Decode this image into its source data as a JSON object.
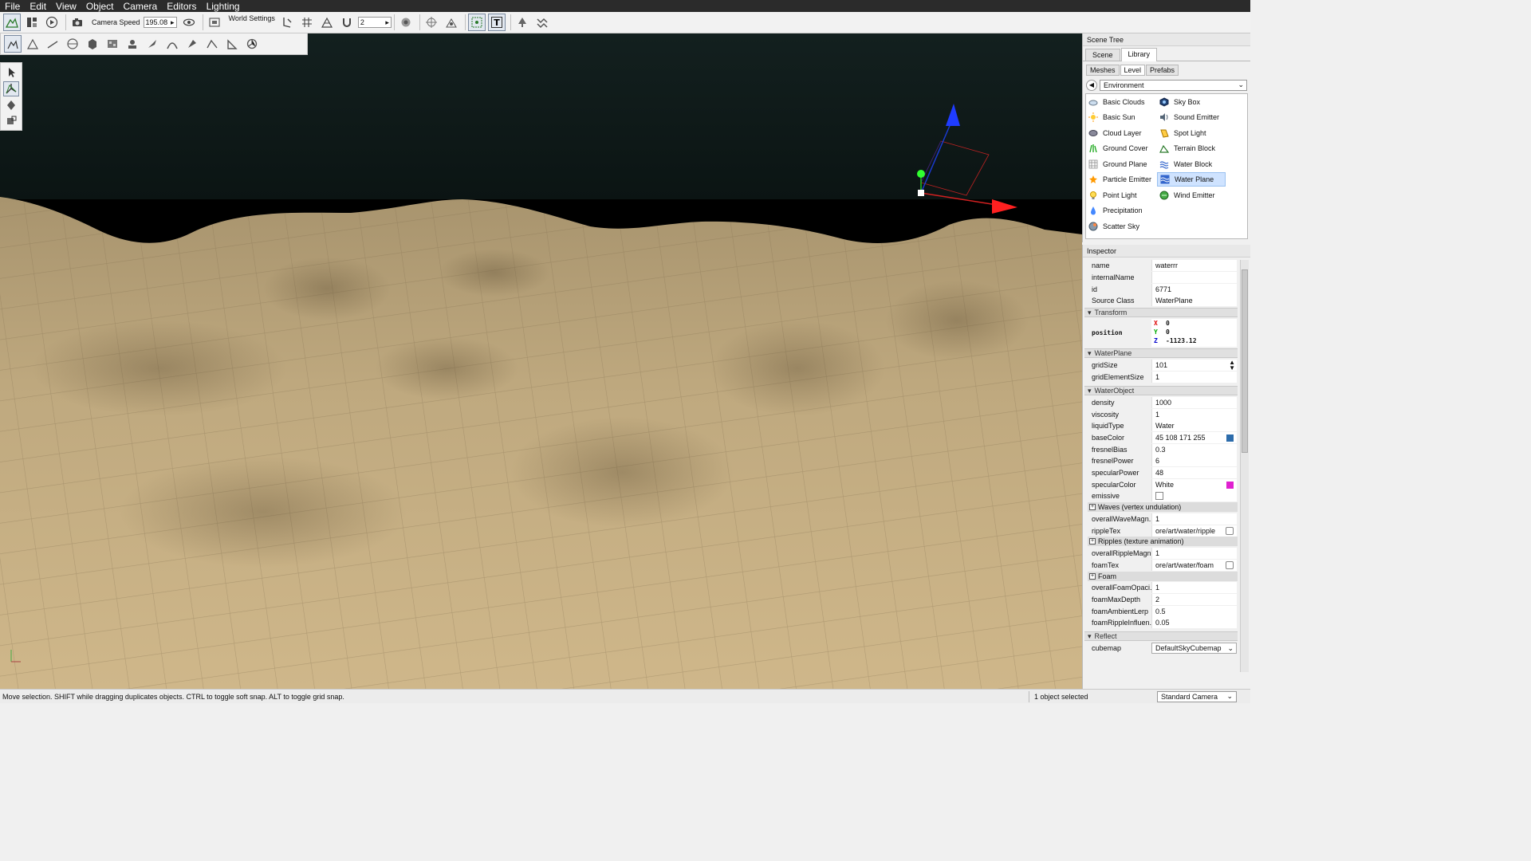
{
  "menu": [
    "File",
    "Edit",
    "View",
    "Object",
    "Camera",
    "Editors",
    "Lighting"
  ],
  "toolbar": {
    "camera_speed_label": "Camera Speed",
    "camera_speed_value": "195.08",
    "world_settings_label": "World Settings",
    "snap_value": "2"
  },
  "scene_tree": {
    "title": "Scene Tree",
    "tabs": [
      "Scene",
      "Library"
    ],
    "selected_tab": "Library",
    "subtabs": [
      "Meshes",
      "Level",
      "Prefabs"
    ],
    "selected_subtab": "Level",
    "category": "Environment",
    "items_left": [
      "Basic Clouds",
      "Basic Sun",
      "Cloud Layer",
      "Ground Cover",
      "Ground Plane",
      "Particle Emitter",
      "Point Light",
      "Precipitation",
      "Scatter Sky"
    ],
    "items_right": [
      "Sky Box",
      "Sound Emitter",
      "Spot Light",
      "Terrain Block",
      "Water Block",
      "Water Plane",
      "Wind Emitter"
    ],
    "selected_item": "Water Plane"
  },
  "inspector": {
    "title": "Inspector",
    "name_label": "name",
    "name_value": "waterrr",
    "internal_label": "internalName",
    "internal_value": "",
    "id_label": "id",
    "id_value": "6771",
    "source_label": "Source Class",
    "source_value": "WaterPlane",
    "transform_group": "Transform",
    "position_label": "position",
    "pos_x_axis": "X",
    "pos_x": "0",
    "pos_y_axis": "Y",
    "pos_y": "0",
    "pos_z_axis": "Z",
    "pos_z": "-1123.12",
    "waterplane_group": "WaterPlane",
    "gridsize_label": "gridSize",
    "gridsize_value": "101",
    "gridelem_label": "gridElementSize",
    "gridelem_value": "1",
    "waterobject_group": "WaterObject",
    "density_label": "density",
    "density_value": "1000",
    "viscosity_label": "viscosity",
    "viscosity_value": "1",
    "liquid_label": "liquidType",
    "liquid_value": "Water",
    "basecolor_label": "baseColor",
    "basecolor_value": "45 108 171 255",
    "basecolor_swatch": "#2d6cab",
    "fresnelbias_label": "fresnelBias",
    "fresnelbias_value": "0.3",
    "fresnelpower_label": "fresnelPower",
    "fresnelpower_value": "6",
    "specpower_label": "specularPower",
    "specpower_value": "48",
    "speccolor_label": "specularColor",
    "speccolor_value": "White",
    "speccolor_swatch": "#e020d0",
    "emissive_label": "emissive",
    "waves_group": "Waves (vertex undulation)",
    "wavemag_label": "overallWaveMagn...",
    "wavemag_value": "1",
    "rippletex_label": "rippleTex",
    "rippletex_value": "ore/art/water/ripple",
    "ripples_group": "Ripples (texture animation)",
    "ripplemag_label": "overallRippleMagn...",
    "ripplemag_value": "1",
    "foamtex_label": "foamTex",
    "foamtex_value": "ore/art/water/foam",
    "foam_group": "Foam",
    "foamopac_label": "overallFoamOpaci...",
    "foamopac_value": "1",
    "foamdepth_label": "foamMaxDepth",
    "foamdepth_value": "2",
    "foamlerp_label": "foamAmbientLerp",
    "foamlerp_value": "0.5",
    "foamripple_label": "foamRippleInfluen...",
    "foamripple_value": "0.05",
    "reflect_group": "Reflect",
    "cubemap_label": "cubemap",
    "cubemap_value": "DefaultSkyCubemap"
  },
  "status": {
    "hint": "Move selection.  SHIFT while dragging duplicates objects.  CTRL to toggle soft snap.  ALT to toggle grid snap.",
    "selection": "1 object selected",
    "camera_mode": "Standard Camera"
  }
}
